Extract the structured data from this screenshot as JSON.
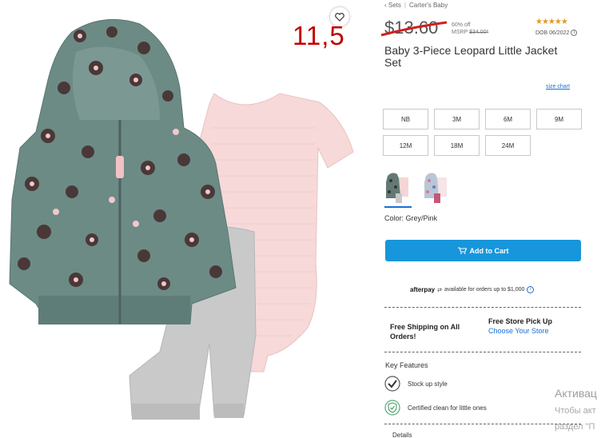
{
  "breadcrumb": {
    "items": [
      "‹ Sets",
      "Carter's Baby"
    ]
  },
  "product": {
    "price": "$13.60",
    "discount": "60% off",
    "msrp_label": "MSRP",
    "msrp_value": "$34.00*",
    "rating_stars": "★★★★★",
    "dob": "DOB 06/2022",
    "title": "Baby 3-Piece Leopard Little Jacket Set",
    "size_chart_label": "size chart",
    "sizes": [
      "NB",
      "3M",
      "6M",
      "9M",
      "12M",
      "18M",
      "24M"
    ],
    "color_label": "Color: Grey/Pink",
    "add_to_cart_label": "Add to Cart"
  },
  "annotation": {
    "text": "11,5"
  },
  "afterpay": {
    "brand": "afterpay",
    "text": "available for orders up to $1,000",
    "info": "i"
  },
  "fulfillment": {
    "shipping": "Free Shipping on All Orders!",
    "pickup_title": "Free Store Pick Up",
    "pickup_link": "Choose Your Store"
  },
  "key_features": {
    "title": "Key Features",
    "items": [
      "Stock up style",
      "Certified clean for little ones"
    ]
  },
  "details_label": "Details",
  "windows": {
    "activate": "Активац",
    "line1": "Чтобы акт",
    "line2": "раздел \"П"
  },
  "colors": {
    "accent": "#1896db",
    "link": "#1a6fd3",
    "annotation": "#c00000",
    "star": "#e49a1b"
  },
  "icons": {
    "wishlist": "heart-icon",
    "cart": "cart-icon",
    "feature1": "hanger-check-icon",
    "feature2": "shield-check-icon"
  }
}
